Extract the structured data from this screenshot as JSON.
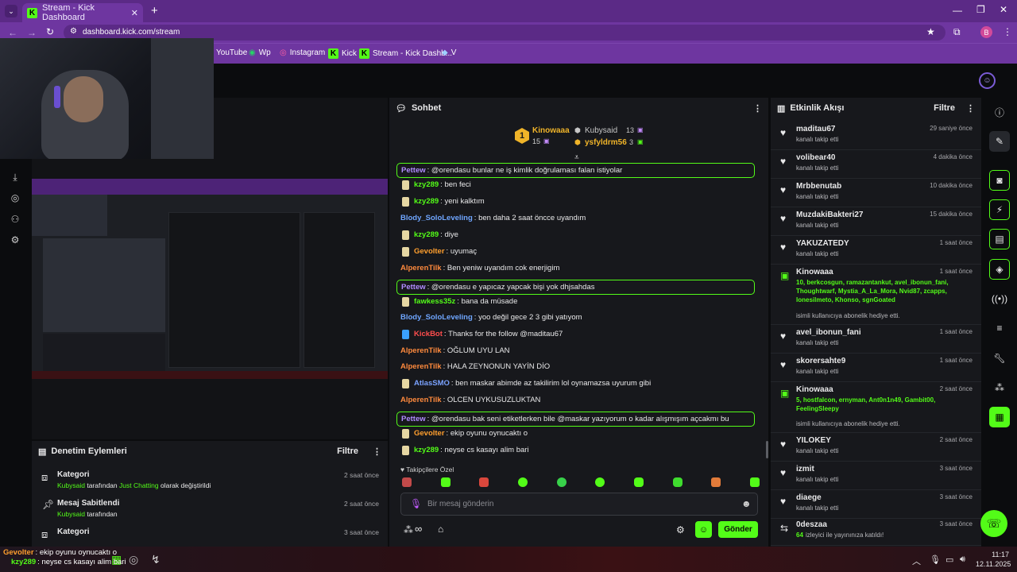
{
  "browser": {
    "tab_title": "Stream - Kick Dashboard",
    "new_tab": "+",
    "url": "dashboard.kick.com/stream",
    "profile_initial": "B",
    "bookmarks": [
      "YouTube",
      "Wp",
      "Instagram",
      "Kick",
      "Stream - Kick Dashb...",
      "V"
    ]
  },
  "preview": {
    "panel_title": ""
  },
  "moderation": {
    "title": "Denetim Eylemleri",
    "filter": "Filtre",
    "rows": [
      {
        "title": "Kategori",
        "user": "Kubysaid",
        "text_mid": "tarafından",
        "category": "Just Chatting",
        "text_end": "olarak değiştirildi",
        "time": "2 saat önce",
        "icon": "category-icon"
      },
      {
        "title": "Mesaj Sabitlendi",
        "user": "Kubysaid",
        "text_mid": "tarafından",
        "category": "",
        "text_end": "",
        "time": "2 saat önce",
        "icon": "pin-icon"
      },
      {
        "title": "Kategori",
        "user": "",
        "text_mid": "",
        "category": "",
        "text_end": "",
        "time": "3 saat önce",
        "icon": "category-icon"
      }
    ]
  },
  "chat": {
    "title": "Sohbet",
    "leaderboard": {
      "first_name": "Kinowaaa",
      "first_count": "15",
      "first_rank": "1",
      "second_name": "Kubysaid",
      "second_count": "13",
      "third_name": "ysfyldrm56",
      "third_count": "3"
    },
    "messages": [
      {
        "user": "Pettew",
        "text": ": @orendasu bunlar ne iş kimlik doğrulaması falan istiyolar",
        "color": "#b18cff",
        "highlight": true,
        "badge": ""
      },
      {
        "user": "kzy289",
        "text": ": ben feci",
        "color": "#53fc18",
        "highlight": false,
        "badge": "#e6d7a3"
      },
      {
        "user": "kzy289",
        "text": ": yeni kalktım",
        "color": "#53fc18",
        "highlight": false,
        "badge": "#e6d7a3"
      },
      {
        "user": "Blody_SoloLeveling",
        "text": ": ben daha 2 saat öncce uyandım",
        "color": "#6fa6ff",
        "highlight": false,
        "badge": ""
      },
      {
        "user": "kzy289",
        "text": ": diye",
        "color": "#53fc18",
        "highlight": false,
        "badge": "#e6d7a3"
      },
      {
        "user": "Gevolter",
        "text": ": uyumaç",
        "color": "#ff9f2e",
        "highlight": false,
        "badge": "#e6d7a3"
      },
      {
        "user": "AlperenTilk",
        "text": ": Ben yeniw uyandım cok enerjigim",
        "color": "#ff8a3d",
        "highlight": false,
        "badge": ""
      },
      {
        "user": "Pettew",
        "text": ": @orendasu e yapıcaz yapcak bişi yok dhjsahdas",
        "color": "#b18cff",
        "highlight": true,
        "badge": ""
      },
      {
        "user": "fawkess35z",
        "text": ": bana da müsade",
        "color": "#53fc18",
        "highlight": false,
        "badge": "#e6d7a3"
      },
      {
        "user": "Blody_SoloLeveling",
        "text": ": yoo değil gece 2 3 gibi yatıyom",
        "color": "#6fa6ff",
        "highlight": false,
        "badge": ""
      },
      {
        "user": "KickBot",
        "text": ": Thanks for the follow @maditau67",
        "color": "#ff4d4d",
        "highlight": false,
        "badge": "#3aa0ff"
      },
      {
        "user": "AlperenTilk",
        "text": ": OĞLUM UYU LAN",
        "color": "#ff8a3d",
        "highlight": false,
        "badge": ""
      },
      {
        "user": "AlperenTilk",
        "text": ": HALA ZEYNONUN YAYİN DİO",
        "color": "#ff8a3d",
        "highlight": false,
        "badge": ""
      },
      {
        "user": "AtlasSMO",
        "text": ": ben maskar abimde az takilirim lol oynamazsa uyurum gibi",
        "color": "#7aa2ff",
        "highlight": false,
        "badge": "#e6d7a3"
      },
      {
        "user": "AlperenTilk",
        "text": ": OLCEN UYKUSUZLUKTAN",
        "color": "#ff8a3d",
        "highlight": false,
        "badge": ""
      },
      {
        "user": "Pettew",
        "text": ": @orendasu bak seni etiketlerken bile @maskar yazıyorum o kadar alışmışım açcakmı bu",
        "color": "#b18cff",
        "highlight": true,
        "badge": ""
      },
      {
        "user": "Gevolter",
        "text": ": ekip oyunu oynucaktı o",
        "color": "#ff9f2e",
        "highlight": false,
        "badge": "#e6d7a3"
      },
      {
        "user": "kzy289",
        "text": ": neyse cs kasayı alim bari",
        "color": "#53fc18",
        "highlight": false,
        "badge": "#e6d7a3"
      }
    ],
    "emote_label": "Takipçilere Özel",
    "input_placeholder": "Bir mesaj gönderin",
    "send_label": "Gönder"
  },
  "activity": {
    "title": "Etkinlik Akışı",
    "filter": "Filtre",
    "items": [
      {
        "name": "maditau67",
        "sub": "kanalı takip etti",
        "time": "29 saniye önce",
        "extra": ""
      },
      {
        "name": "volibear40",
        "sub": "kanalı takip etti",
        "time": "4 dakika önce",
        "extra": ""
      },
      {
        "name": "Mrbbenutab",
        "sub": "kanalı takip etti",
        "time": "10 dakika önce",
        "extra": ""
      },
      {
        "name": "MuzdakiBakteri27",
        "sub": "kanalı takip etti",
        "time": "15 dakika önce",
        "extra": ""
      },
      {
        "name": "YAKUZATEDY",
        "sub": "kanalı takip etti",
        "time": "1 saat önce",
        "extra": ""
      },
      {
        "name": "Kinowaaa",
        "sub": "isimli kullanıcıya abonelik hediye etti.",
        "time": "1 saat önce",
        "extra": "10, berkcosgun, ramazantankut, avel_ibonun_fani, Thoughtwarf, Mystia_A_La_Mora, Nvid87, zcapps, lonesilmeto, Khonso, sgnGoated"
      },
      {
        "name": "avel_ibonun_fani",
        "sub": "kanalı takip etti",
        "time": "1 saat önce",
        "extra": ""
      },
      {
        "name": "skorersahte9",
        "sub": "kanalı takip etti",
        "time": "1 saat önce",
        "extra": ""
      },
      {
        "name": "Kinowaaa",
        "sub": "isimli kullanıcıya abonelik hediye etti.",
        "time": "2 saat önce",
        "extra": "5, hostfalcon, ernyman, Ant0n1n49, Gambit00, FeelingSleepy"
      },
      {
        "name": "YILOKEY",
        "sub": "kanalı takip etti",
        "time": "2 saat önce",
        "extra": ""
      },
      {
        "name": "izmit",
        "sub": "kanalı takip etti",
        "time": "3 saat önce",
        "extra": ""
      },
      {
        "name": "diaege",
        "sub": "kanalı takip etti",
        "time": "3 saat önce",
        "extra": ""
      },
      {
        "name": "0deszaa",
        "sub": "izleyici ile yayınınıza katıldı!",
        "time": "3 saat önce",
        "extra": "64"
      }
    ]
  },
  "overlay": {
    "line1_user": "Gevolter",
    "line1_text": ": ekip oyunu oynucaktı o",
    "line2_user": "kzy289",
    "line2_text": ": neyse cs kasayı alim bari"
  },
  "taskbar": {
    "time": "11:17",
    "date": "12.11.2025"
  },
  "colors": {
    "kick_green": "#53fc18",
    "chrome_purple": "#6e36a0",
    "panel_bg": "#17181c"
  }
}
